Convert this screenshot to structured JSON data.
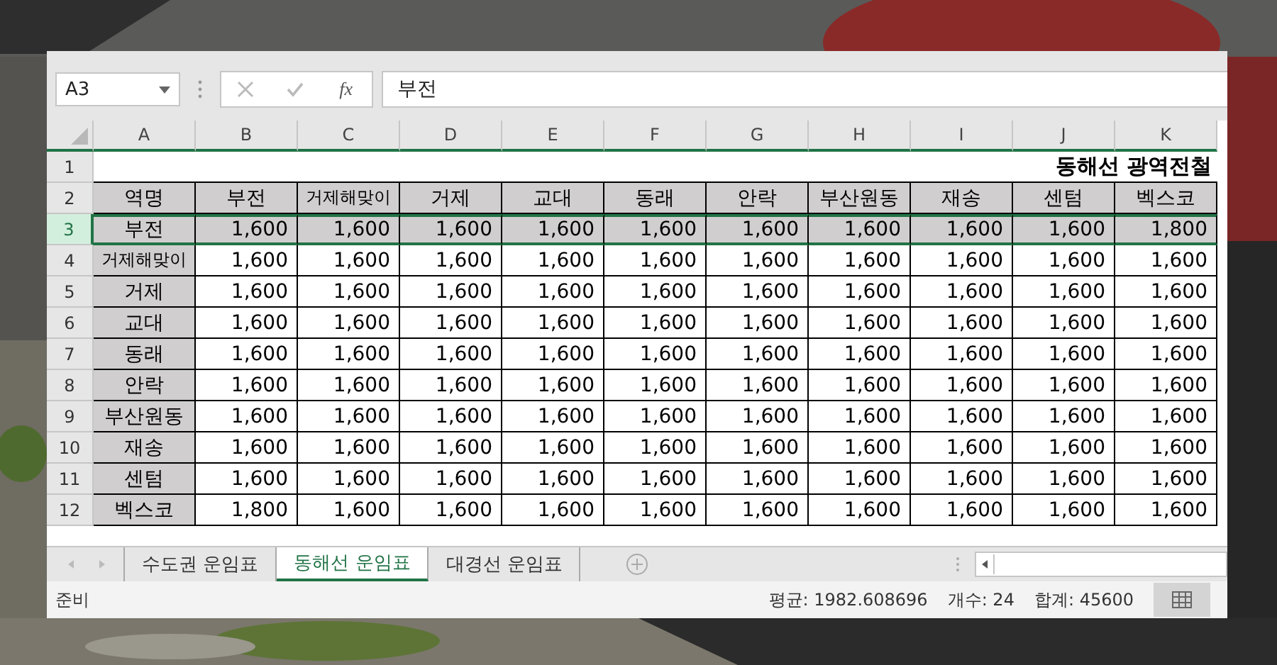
{
  "formula_bar": {
    "name_box": "A3",
    "function_button": "fx",
    "formula": "부전"
  },
  "sheet": {
    "columns": [
      "A",
      "B",
      "C",
      "D",
      "E",
      "F",
      "G",
      "H",
      "I",
      "J",
      "K"
    ],
    "rows": [
      {
        "number": "1",
        "kind": "title",
        "selected": false,
        "cells": [
          "",
          "",
          "",
          "",
          "",
          "",
          "",
          "",
          "",
          "동해선 광역전철"
        ]
      },
      {
        "number": "2",
        "kind": "header",
        "selected": false,
        "cells": [
          "역명",
          "부전",
          "거제해맞이",
          "거제",
          "교대",
          "동래",
          "안락",
          "부산원동",
          "재송",
          "센텀",
          "벡스코"
        ]
      },
      {
        "number": "3",
        "kind": "data",
        "selected": true,
        "cells": [
          "부전",
          "1,600",
          "1,600",
          "1,600",
          "1,600",
          "1,600",
          "1,600",
          "1,600",
          "1,600",
          "1,600",
          "1,800"
        ]
      },
      {
        "number": "4",
        "kind": "data",
        "selected": false,
        "cells": [
          "거제해맞이",
          "1,600",
          "1,600",
          "1,600",
          "1,600",
          "1,600",
          "1,600",
          "1,600",
          "1,600",
          "1,600",
          "1,600"
        ]
      },
      {
        "number": "5",
        "kind": "data",
        "selected": false,
        "cells": [
          "거제",
          "1,600",
          "1,600",
          "1,600",
          "1,600",
          "1,600",
          "1,600",
          "1,600",
          "1,600",
          "1,600",
          "1,600"
        ]
      },
      {
        "number": "6",
        "kind": "data",
        "selected": false,
        "cells": [
          "교대",
          "1,600",
          "1,600",
          "1,600",
          "1,600",
          "1,600",
          "1,600",
          "1,600",
          "1,600",
          "1,600",
          "1,600"
        ]
      },
      {
        "number": "7",
        "kind": "data",
        "selected": false,
        "cells": [
          "동래",
          "1,600",
          "1,600",
          "1,600",
          "1,600",
          "1,600",
          "1,600",
          "1,600",
          "1,600",
          "1,600",
          "1,600"
        ]
      },
      {
        "number": "8",
        "kind": "data",
        "selected": false,
        "cells": [
          "안락",
          "1,600",
          "1,600",
          "1,600",
          "1,600",
          "1,600",
          "1,600",
          "1,600",
          "1,600",
          "1,600",
          "1,600"
        ]
      },
      {
        "number": "9",
        "kind": "data",
        "selected": false,
        "cells": [
          "부산원동",
          "1,600",
          "1,600",
          "1,600",
          "1,600",
          "1,600",
          "1,600",
          "1,600",
          "1,600",
          "1,600",
          "1,600"
        ]
      },
      {
        "number": "10",
        "kind": "data",
        "selected": false,
        "cells": [
          "재송",
          "1,600",
          "1,600",
          "1,600",
          "1,600",
          "1,600",
          "1,600",
          "1,600",
          "1,600",
          "1,600",
          "1,600"
        ]
      },
      {
        "number": "11",
        "kind": "data",
        "selected": false,
        "cells": [
          "센텀",
          "1,600",
          "1,600",
          "1,600",
          "1,600",
          "1,600",
          "1,600",
          "1,600",
          "1,600",
          "1,600",
          "1,600"
        ]
      },
      {
        "number": "12",
        "kind": "data",
        "selected": false,
        "cells": [
          "벡스코",
          "1,800",
          "1,600",
          "1,600",
          "1,600",
          "1,600",
          "1,600",
          "1,600",
          "1,600",
          "1,600",
          "1,600"
        ]
      }
    ]
  },
  "sheet_tabs": [
    {
      "label": "수도권 운임표",
      "selected": false
    },
    {
      "label": "동해선 운임표",
      "selected": true
    },
    {
      "label": "대경선 운임표",
      "selected": false
    }
  ],
  "status_bar": {
    "mode": "준비",
    "average": "평균: 1982.608696",
    "count": "개수: 24",
    "sum": "합계: 45600"
  }
}
